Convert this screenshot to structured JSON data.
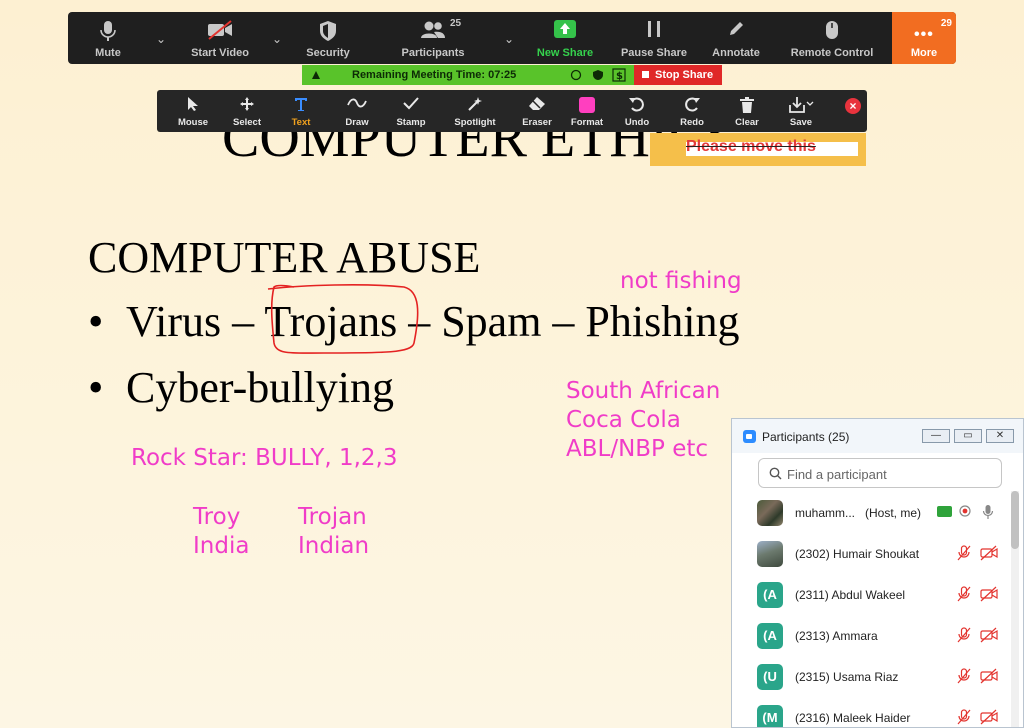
{
  "meeting_toolbar": {
    "mute": "Mute",
    "start_video": "Start Video",
    "security": "Security",
    "participants": "Participants",
    "participants_count": "25",
    "new_share": "New Share",
    "pause_share": "Pause Share",
    "annotate": "Annotate",
    "remote_control": "Remote Control",
    "more": "More",
    "more_count": "29",
    "colors": {
      "bar": "#1f1f1f",
      "new_share": "#35c24a",
      "more": "#f26d21"
    }
  },
  "meeting_status": {
    "remaining_time": "Remaining Meeting Time: 07:25",
    "stop_share": "Stop Share"
  },
  "annotation_toolbar": {
    "tools": [
      {
        "label": "Mouse",
        "icon": "cursor-icon"
      },
      {
        "label": "Select",
        "icon": "move-icon"
      },
      {
        "label": "Text",
        "icon": "text-icon",
        "active": true
      },
      {
        "label": "Draw",
        "icon": "draw-icon"
      },
      {
        "label": "Stamp",
        "icon": "checkmark-icon"
      },
      {
        "label": "Spotlight",
        "icon": "spotlight-icon"
      },
      {
        "label": "Eraser",
        "icon": "eraser-icon"
      },
      {
        "label": "Format",
        "icon": "format-swatch-icon"
      },
      {
        "label": "Undo",
        "icon": "undo-icon"
      },
      {
        "label": "Redo",
        "icon": "redo-icon"
      },
      {
        "label": "Clear",
        "icon": "trash-icon"
      },
      {
        "label": "Save",
        "icon": "save-icon"
      }
    ],
    "active_color": "#f0a11e",
    "format_color": "#ff3fbf"
  },
  "slide": {
    "title_partial": "COMPUTER ETHICS",
    "heading": "COMPUTER ABUSE",
    "bullet1": "Virus – Trojans – Spam – Phishing",
    "bullet2": "Cyber-bullying",
    "sticky_note": "Please move this",
    "annotations": {
      "not_fishing": "not fishing",
      "south_african": "South African",
      "coca_cola": "Coca Cola",
      "abl_nbp": "ABL/NBP etc",
      "rock_star": "Rock Star: BULLY, 1,2,3",
      "troy": "Troy",
      "india": "India",
      "trojan": "Trojan",
      "indian": "Indian"
    },
    "annotation_color": "#f03cc8"
  },
  "participants_panel": {
    "title": "Participants (25)",
    "search_placeholder": "Find a participant",
    "host": {
      "name": "muhamm...",
      "role": "(Host, me)"
    },
    "participants": [
      {
        "name": "(2302) Humair Shoukat",
        "avatar": ""
      },
      {
        "name": "(2311) Abdul Wakeel",
        "avatar": "(A"
      },
      {
        "name": "(2313) Ammara",
        "avatar": "(A"
      },
      {
        "name": "(2315) Usama Riaz",
        "avatar": "(U"
      },
      {
        "name": "(2316) Maleek Haider",
        "avatar": "(M"
      }
    ]
  }
}
